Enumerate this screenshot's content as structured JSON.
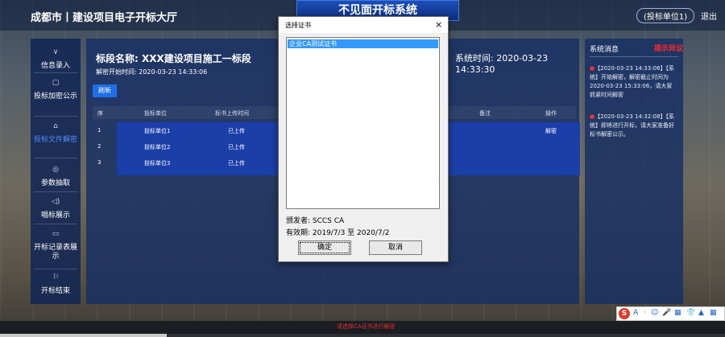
{
  "header": {
    "city": "成都市丨建设项目电子开标大厅",
    "hall_title": "不见面开标系统",
    "user": "(投标单位1)",
    "logout": "退出"
  },
  "sidebar": {
    "items": [
      {
        "label": "信息录入",
        "icon": "chevron-icon",
        "glyph": "∨"
      },
      {
        "label": "投标加密公示",
        "icon": "document-icon",
        "glyph": "▢"
      },
      {
        "label": "投标文件解密",
        "icon": "lock-icon",
        "glyph": "⌂",
        "active": true
      },
      {
        "label": "参数抽取",
        "icon": "target-icon",
        "glyph": "◎"
      },
      {
        "label": "唱标展示",
        "icon": "speaker-icon",
        "glyph": "◁)"
      },
      {
        "label": "开标记录表展示",
        "icon": "table-icon",
        "glyph": "▭"
      },
      {
        "label": "开标结束",
        "icon": "flag-icon",
        "glyph": "⚐"
      }
    ]
  },
  "main": {
    "section_name": "标段名称: XXX建设项目施工一标段",
    "system_time": "系统时间: 2020-03-23 14:33:30",
    "decrypt_start": "解密开始时间: 2020-03-23 14:33:06",
    "refresh_label": "刷新",
    "columns": [
      "序",
      "投标单位",
      "标书上传时间",
      "备注",
      "操作"
    ],
    "rows": [
      {
        "no": "1",
        "bidder": "投标单位1",
        "status": "已上传",
        "action": "解密"
      },
      {
        "no": "2",
        "bidder": "投标单位2",
        "status": "已上传",
        "action": ""
      },
      {
        "no": "3",
        "bidder": "投标单位3",
        "status": "已上传",
        "action": ""
      }
    ]
  },
  "news": {
    "title": "系统消息",
    "alert": "提示异议",
    "items": [
      "【2020-03-23 14:33:06】【系统】开始解密，解密截止时间为2020-03-23 15:33:06，请大家抓紧时间解密",
      "【2020-03-23 14:32:08】【系统】即将进行开标，请大家准备好标书解密公示。"
    ]
  },
  "dialog": {
    "title": "选择证书",
    "close": "×",
    "cert": "企业CA测试证书",
    "issuer": "颁发者: SCCS CA",
    "valid": "有效期: 2019/7/3 至 2020/7/2",
    "ok": "确定",
    "cancel": "取消"
  },
  "toolbar": {
    "logo": "S",
    "items": [
      "A",
      "·",
      "☺",
      "🎤",
      "▦",
      "👕",
      "▲",
      "▦"
    ]
  },
  "footer": {
    "message": "请选择CA证书进行解密",
    "progress": 0.23
  }
}
